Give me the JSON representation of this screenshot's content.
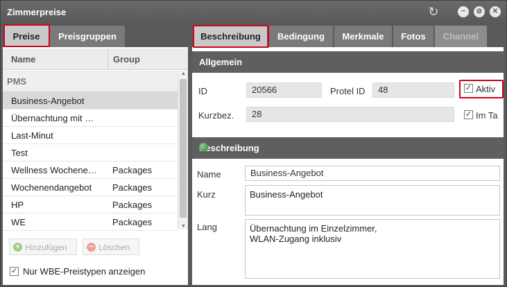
{
  "window": {
    "title": "Zimmerpreise"
  },
  "left": {
    "tabs": [
      {
        "label": "Preise"
      },
      {
        "label": "Preisgruppen"
      }
    ],
    "columns": {
      "name": "Name",
      "group": "Group"
    },
    "group_label": "PMS",
    "rows": [
      {
        "name": "Business-Angebot",
        "group": ""
      },
      {
        "name": "Übernachtung mit …",
        "group": ""
      },
      {
        "name": "Last-Minut",
        "group": ""
      },
      {
        "name": "Test",
        "group": ""
      },
      {
        "name": "Wellness Wochene…",
        "group": "Packages"
      },
      {
        "name": "Wochenendangebot",
        "group": "Packages"
      },
      {
        "name": "HP",
        "group": "Packages"
      },
      {
        "name": "WE",
        "group": "Packages"
      }
    ],
    "add_label": "Hinzufügen",
    "delete_label": "Löschen",
    "filter_label": "Nur WBE-Preistypen anzeigen"
  },
  "right": {
    "tabs": [
      {
        "label": "Beschreibung"
      },
      {
        "label": "Bedingung"
      },
      {
        "label": "Merkmale"
      },
      {
        "label": "Fotos"
      },
      {
        "label": "Channel"
      }
    ],
    "general": {
      "title": "Allgemein",
      "id_label": "ID",
      "id_value": "20566",
      "protel_label": "Protel ID",
      "protel_value": "48",
      "aktiv_label": "Aktiv",
      "kurzbez_label": "Kurzbez.",
      "kurzbez_value": "28",
      "imta_label": "Im Ta"
    },
    "desc": {
      "title": "Beschreibung",
      "name_label": "Name",
      "name_value": "Business-Angebot",
      "kurz_label": "Kurz",
      "kurz_value": "Business-Angebot",
      "lang_label": "Lang",
      "lang_line1": "Übernachtung im Einzelzimmer,",
      "lang_line2": "WLAN-Zugang inklusiv"
    }
  },
  "colors": {
    "highlight": "#d0021b",
    "header": "#5a5a5a"
  },
  "icons": {
    "refresh": "refresh-icon",
    "minimize": "minimize-icon",
    "settings": "settings-icon",
    "close": "close-icon",
    "globe": "globe-icon"
  }
}
